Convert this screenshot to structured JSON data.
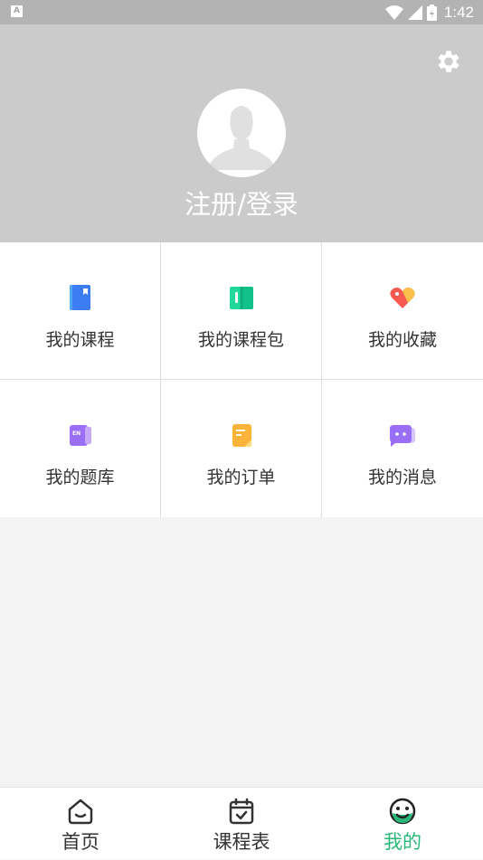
{
  "status_bar": {
    "notification_icon_letter": "A",
    "time": "1:42",
    "icons": [
      "wifi-icon",
      "signal-icon",
      "battery-icon"
    ]
  },
  "profile": {
    "settings_icon": "gear-icon",
    "avatar_icon": "default-avatar-icon",
    "login_label": "注册/登录"
  },
  "menu": [
    {
      "label": "我的课程",
      "icon": "book-icon"
    },
    {
      "label": "我的课程包",
      "icon": "open-book-icon"
    },
    {
      "label": "我的收藏",
      "icon": "heart-tag-icon"
    },
    {
      "label": "我的题库",
      "icon": "question-bank-icon"
    },
    {
      "label": "我的订单",
      "icon": "order-note-icon"
    },
    {
      "label": "我的消息",
      "icon": "chat-bubble-icon"
    }
  ],
  "tabs": [
    {
      "label": "首页",
      "icon": "home-icon",
      "active": false
    },
    {
      "label": "课程表",
      "icon": "calendar-icon",
      "active": false
    },
    {
      "label": "我的",
      "icon": "smiley-icon",
      "active": true
    }
  ],
  "colors": {
    "header_bg": "#cbcbcb",
    "status_bg": "#b3b3b3",
    "accent": "#2ab87a",
    "page_bg": "#f3f3f3"
  }
}
